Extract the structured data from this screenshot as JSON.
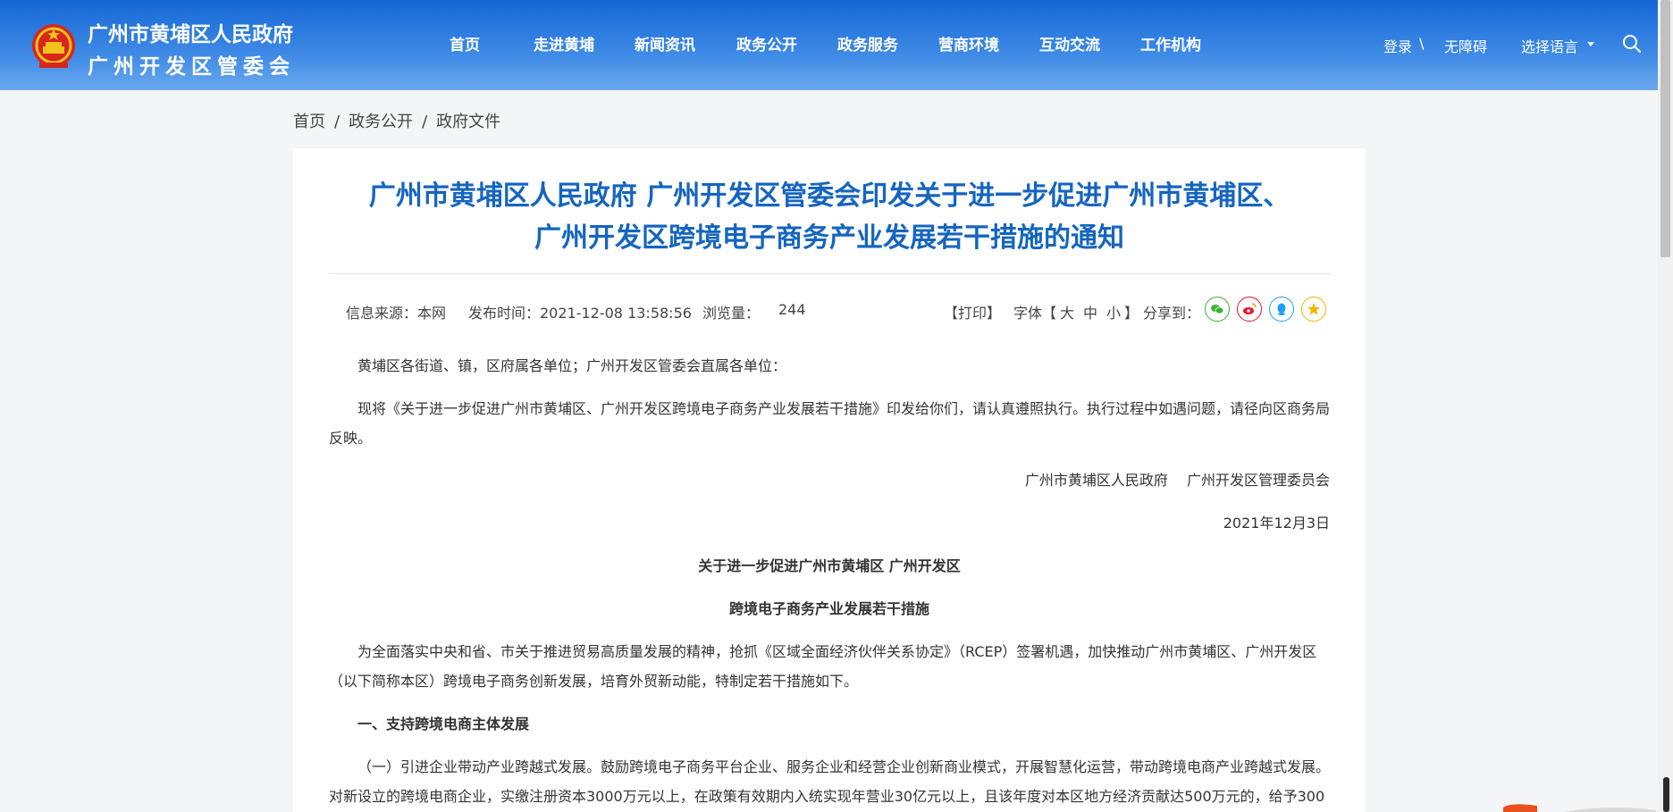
{
  "site": {
    "title_line1": "广州市黄埔区人民政府",
    "title_line2": "广州开发区管委会"
  },
  "nav": [
    {
      "label": "首页"
    },
    {
      "label": "走进黄埔"
    },
    {
      "label": "新闻资讯"
    },
    {
      "label": "政务公开"
    },
    {
      "label": "政务服务"
    },
    {
      "label": "营商环境"
    },
    {
      "label": "互动交流"
    },
    {
      "label": "工作机构"
    }
  ],
  "top_links": {
    "login": "登录",
    "separator": "\\",
    "accessibility": "无障碍",
    "language": "选择语言"
  },
  "breadcrumb": {
    "items": [
      "首页",
      "政务公开",
      "政府文件"
    ],
    "separator": "/"
  },
  "article": {
    "title_line1": "广州市黄埔区人民政府 广州开发区管委会印发关于进一步促进广州市黄埔区、",
    "title_line2": "广州开发区跨境电子商务产业发展若干措施的通知",
    "meta": {
      "source": "信息来源：本网",
      "published": "发布时间：2021-12-08 13:58:56",
      "views_label": "浏览量：",
      "views": "244",
      "print": "【打印】",
      "font_label": "字体【",
      "font_large": "大",
      "font_medium": "中",
      "font_small": "小",
      "font_close": "】",
      "share_label": "分享到："
    },
    "share_icons": [
      "wechat-icon",
      "weibo-icon",
      "qq-icon",
      "qzone-icon"
    ],
    "body": {
      "addressee": "黄埔区各街道、镇，区府属各单位；广州开发区管委会直属各单位：",
      "intro_line1": "现将《关于进一步促进广州市黄埔区、广州开发区跨境电子商务产业发展若干措施》印发给你们，请认真遵照执行。执行过程中如遇问题，请径向区商务局",
      "intro_line2": "反映。",
      "signature": "广州市黄埔区人民政府　 广州开发区管理委员会",
      "date": "2021年12月3日",
      "heading1": "关于进一步促进广州市黄埔区 广州开发区",
      "heading2": "跨境电子商务产业发展若干措施",
      "preamble_line1": "为全面落实中央和省、市关于推进贸易高质量发展的精神，抢抓《区域全面经济伙伴关系协定》（RCEP）签署机遇，加快推动广州市黄埔区、广州开发区",
      "preamble_line2": "（以下简称本区）跨境电子商务创新发展，培育外贸新动能，特制定若干措施如下。",
      "section1": "一、支持跨境电商主体发展",
      "item1_line1": "（一）引进企业带动产业跨越式发展。鼓励跨境电子商务平台企业、服务企业和经营企业创新商业模式，开展智慧化运营，带动跨境电商产业跨越式发展。",
      "item1_line2": "对新设立的跨境电商企业，实缴注册资本3000万元以上，在政策有效期内入统实现年营业30亿元以上，且该年度对本区地方经济贡献达500万元的，给予300"
    }
  },
  "colors": {
    "header_start": "#1567d6",
    "title_blue": "#1565c0",
    "wechat": "#3cb034",
    "weibo": "#e6162d",
    "qq": "#1e9fff",
    "qzone": "#f5b400"
  }
}
